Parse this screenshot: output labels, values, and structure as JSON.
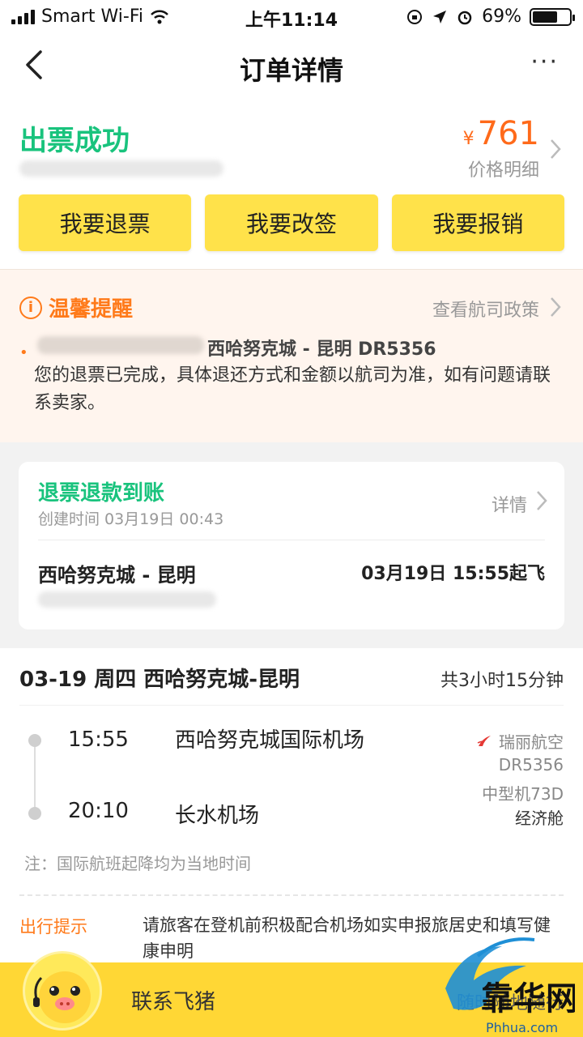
{
  "status_bar": {
    "carrier": "Smart Wi-Fi",
    "time": "上午11:14",
    "battery": "69%",
    "battery_level": 0.69
  },
  "nav": {
    "title": "订单详情",
    "more": "···"
  },
  "order_status": {
    "title": "出票成功",
    "currency": "¥",
    "price": "761",
    "price_detail": "价格明细"
  },
  "actions": {
    "refund": "我要退票",
    "change": "我要改签",
    "reimburse": "我要报销"
  },
  "notice": {
    "title": "温馨提醒",
    "link": "查看航司政策",
    "route": "西哈努克城 - 昆明 DR5356",
    "body": "您的退票已完成，具体退还方式和金额以航司为准，如有问题请联系卖家。"
  },
  "refund_card": {
    "title": "退票退款到账",
    "created": "创建时间 03月19日 00:43",
    "link": "详情",
    "route": "西哈努克城 - 昆明",
    "departure": "03月19日 15:55起飞"
  },
  "flight": {
    "header": "03-19 周四 西哈努克城-昆明",
    "duration": "共3小时15分钟",
    "dep_time": "15:55",
    "dep_airport": "西哈努克城国际机场",
    "arr_time": "20:10",
    "arr_airport": "长水机场",
    "airline": "瑞丽航空",
    "flight_no": "DR5356",
    "aircraft": "中型机73D",
    "cabin": "经济舱",
    "note": "注：国际航班起降均为当地时间",
    "tip_label": "出行提示",
    "tip_text": "请旅客在登机前积极配合机场如实申报旅居史和填写健康申明"
  },
  "bottom": {
    "contact": "联系飞猪",
    "anytime": "随时随地随行"
  },
  "watermark": {
    "text": "靠华网",
    "domain": "Phhua.com"
  },
  "colors": {
    "accent_yellow": "#ffe24a",
    "success_green": "#19c37d",
    "price_orange": "#ff6a1a",
    "notice_bg": "#fff5ee"
  }
}
